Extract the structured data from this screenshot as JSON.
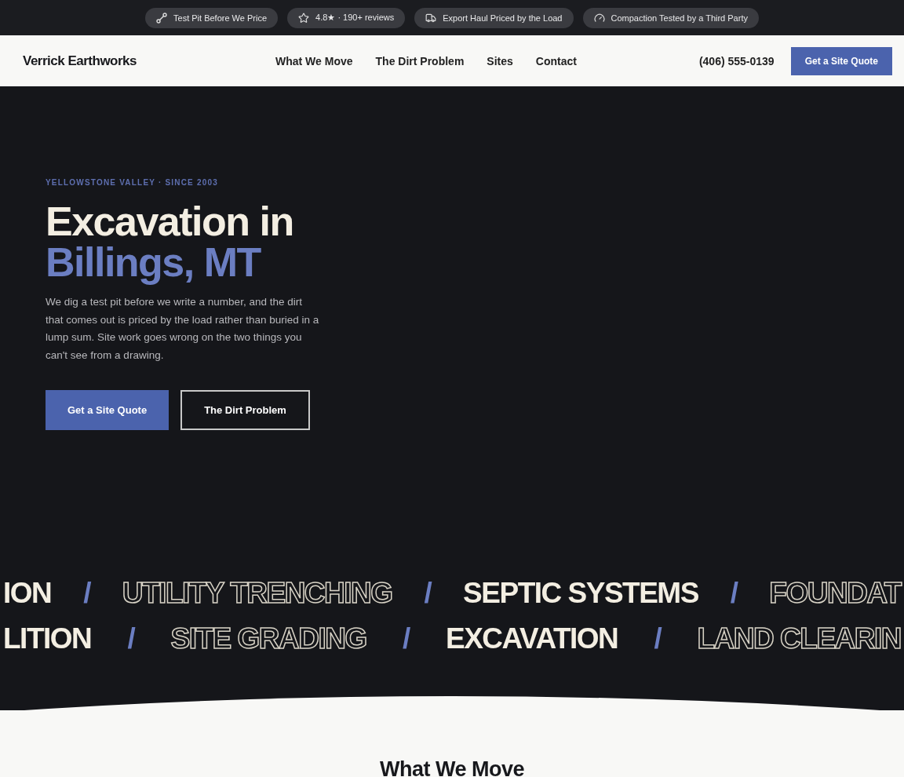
{
  "trust_bar": [
    {
      "label": "Test Pit Before We Price"
    },
    {
      "label": "4.8★ · 190+ reviews"
    },
    {
      "label": "Export Haul Priced by the Load"
    },
    {
      "label": "Compaction Tested by a Third Party"
    }
  ],
  "header": {
    "logo": "Verrick Earthworks",
    "nav": [
      "What We Move",
      "The Dirt Problem",
      "Sites",
      "Contact"
    ],
    "phone": "(406) 555-0139",
    "cta": "Get a Site Quote"
  },
  "hero": {
    "eyebrow": "YELLOWSTONE VALLEY · SINCE 2003",
    "title_line_1": "Excavation in",
    "title_line_2": "Billings, MT",
    "body": "We dig a test pit before we write a number, and the dirt that comes out is priced by the load rather than buried in a lump sum. Site work goes wrong on the two things you can't see from a drawing.",
    "buttons": [
      {
        "label": "Get a Site Quote",
        "kind": "primary"
      },
      {
        "label": "The Dirt Problem",
        "kind": "outline"
      }
    ]
  },
  "marquee": [
    {
      "items": [
        {
          "text": "ION",
          "kind": "solid"
        },
        {
          "text": "/",
          "kind": "separator"
        },
        {
          "text": "UTILITY TRENCHING",
          "kind": "outline"
        },
        {
          "text": "/",
          "kind": "separator"
        },
        {
          "text": "SEPTIC SYSTEMS",
          "kind": "solid"
        },
        {
          "text": "/",
          "kind": "separator"
        },
        {
          "text": "FOUNDAT",
          "kind": "outline"
        }
      ]
    },
    {
      "items": [
        {
          "text": "LITION",
          "kind": "solid"
        },
        {
          "text": "/",
          "kind": "separator"
        },
        {
          "text": "SITE GRADING",
          "kind": "outline"
        },
        {
          "text": "/",
          "kind": "separator"
        },
        {
          "text": "EXCAVATION",
          "kind": "solid"
        },
        {
          "text": "/",
          "kind": "separator"
        },
        {
          "text": "LAND CLEARIN",
          "kind": "outline"
        }
      ]
    }
  ],
  "next_section": {
    "title": "What We Move"
  }
}
